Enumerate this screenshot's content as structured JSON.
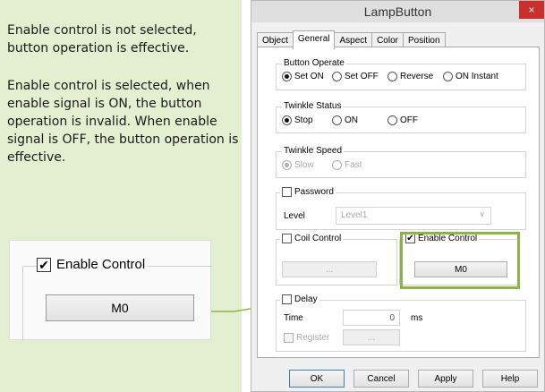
{
  "notes": {
    "paragraph_1": "Enable control is not selected, button operation is effective.",
    "paragraph_2": "Enable control is selected, when enable signal is ON, the button operation is invalid. When enable signal is OFF, the button operation is effective."
  },
  "zoom": {
    "check_label": "Enable Control",
    "checked": true,
    "button_label": "M0"
  },
  "dialog": {
    "title": "LampButton",
    "close_glyph": "×",
    "tabs": [
      {
        "label": "Object",
        "active": false
      },
      {
        "label": "General",
        "active": true
      },
      {
        "label": "Aspect",
        "active": false
      },
      {
        "label": "Color",
        "active": false
      },
      {
        "label": "Position",
        "active": false
      }
    ],
    "button_operate": {
      "legend": "Button Operate",
      "options": [
        "Set ON",
        "Set OFF",
        "Reverse",
        "ON Instant"
      ],
      "selected": "Set ON"
    },
    "twinkle_status": {
      "legend": "Twinkle Status",
      "options": [
        "Stop",
        "ON",
        "OFF"
      ],
      "selected": "Stop"
    },
    "twinkle_speed": {
      "legend": "Twinkle Speed",
      "options": [
        "Slow",
        "Fast"
      ],
      "selected": "Slow",
      "disabled": true
    },
    "password": {
      "label": "Password",
      "checked": false,
      "level_label": "Level",
      "level_value": "Level1"
    },
    "coil_control": {
      "label": "Coil Control",
      "checked": false,
      "button_label": "..."
    },
    "enable_control": {
      "label": "Enable Control",
      "checked": true,
      "button_label": "M0"
    },
    "delay": {
      "label": "Delay",
      "checked": false,
      "time_label": "Time",
      "time_value": "0",
      "unit": "ms",
      "register_label": "Register",
      "register_button": "..."
    },
    "footer": {
      "ok": "OK",
      "cancel": "Cancel",
      "apply": "Apply",
      "help": "Help"
    }
  },
  "colors": {
    "note_panel_bg": "#e4eed0",
    "highlight_border": "#8fb446",
    "close_button_bg": "#c9302c"
  }
}
